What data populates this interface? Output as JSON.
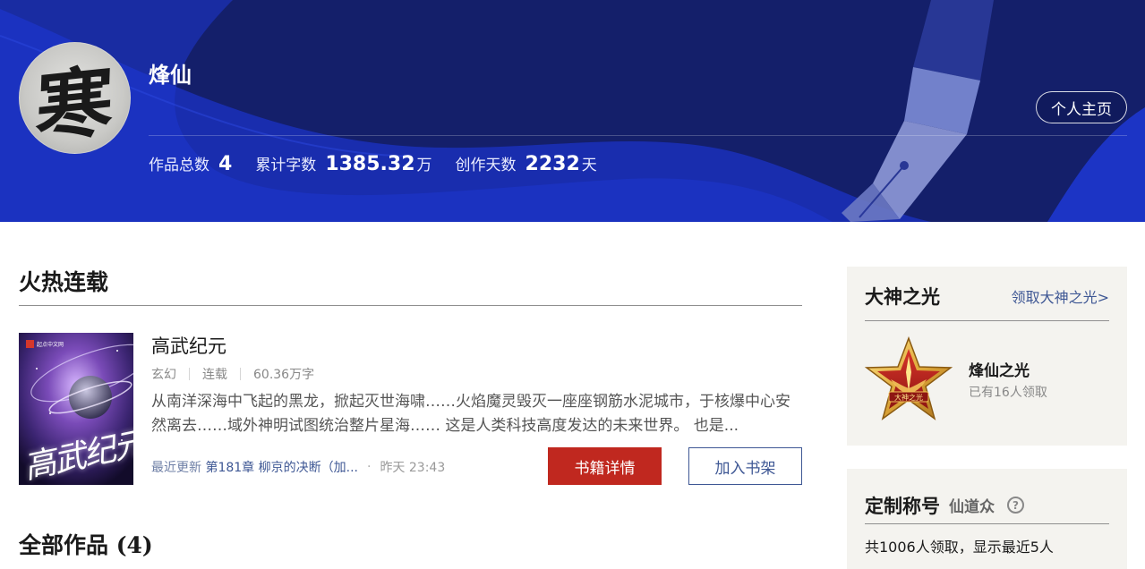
{
  "author": {
    "name": "烽仙",
    "avatar_glyph": "寒",
    "home_button": "个人主页"
  },
  "stats": [
    {
      "label": "作品总数",
      "value": "4",
      "unit": ""
    },
    {
      "label": "累计字数",
      "value": "1385.32",
      "unit": "万"
    },
    {
      "label": "创作天数",
      "value": "2232",
      "unit": "天"
    }
  ],
  "sections": {
    "hot": "火热连载",
    "all": "全部作品 (4)"
  },
  "book": {
    "cover_logo": "起点中文网",
    "cover_title": "高武纪元",
    "title": "高武纪元",
    "genre": "玄幻",
    "status": "连载",
    "words": "60.36万字",
    "description": "从南洋深海中飞起的黑龙，掀起灭世海啸……火焰魔灵毁灭一座座钢筋水泥城市，于核爆中心安然离去……域外神明试图统治整片星海…… 这是人类科技高度发达的未来世界。 也是...",
    "update_prefix": "最近更新",
    "update_chapter": "第181章 柳京的决断（加...",
    "update_dot": "·",
    "update_time": "昨天 23:43",
    "detail_button": "书籍详情",
    "shelf_button": "加入书架"
  },
  "sidebar": {
    "god_card": {
      "title": "大神之光",
      "link": "领取大神之光>",
      "badge_text": "大神之光",
      "badge_name": "烽仙之光",
      "badge_count": "已有16人领取"
    },
    "title_card": {
      "title": "定制称号",
      "subtitle": "仙道众",
      "help": "?",
      "summary": "共1006人领取，显示最近5人"
    }
  },
  "colors": {
    "banner_bg": "#141f6a",
    "banner_wave": "#1d34c4",
    "primary_red": "#c0281f",
    "link_blue": "#3e5794",
    "sidebar_bg": "#f4f3ef"
  }
}
